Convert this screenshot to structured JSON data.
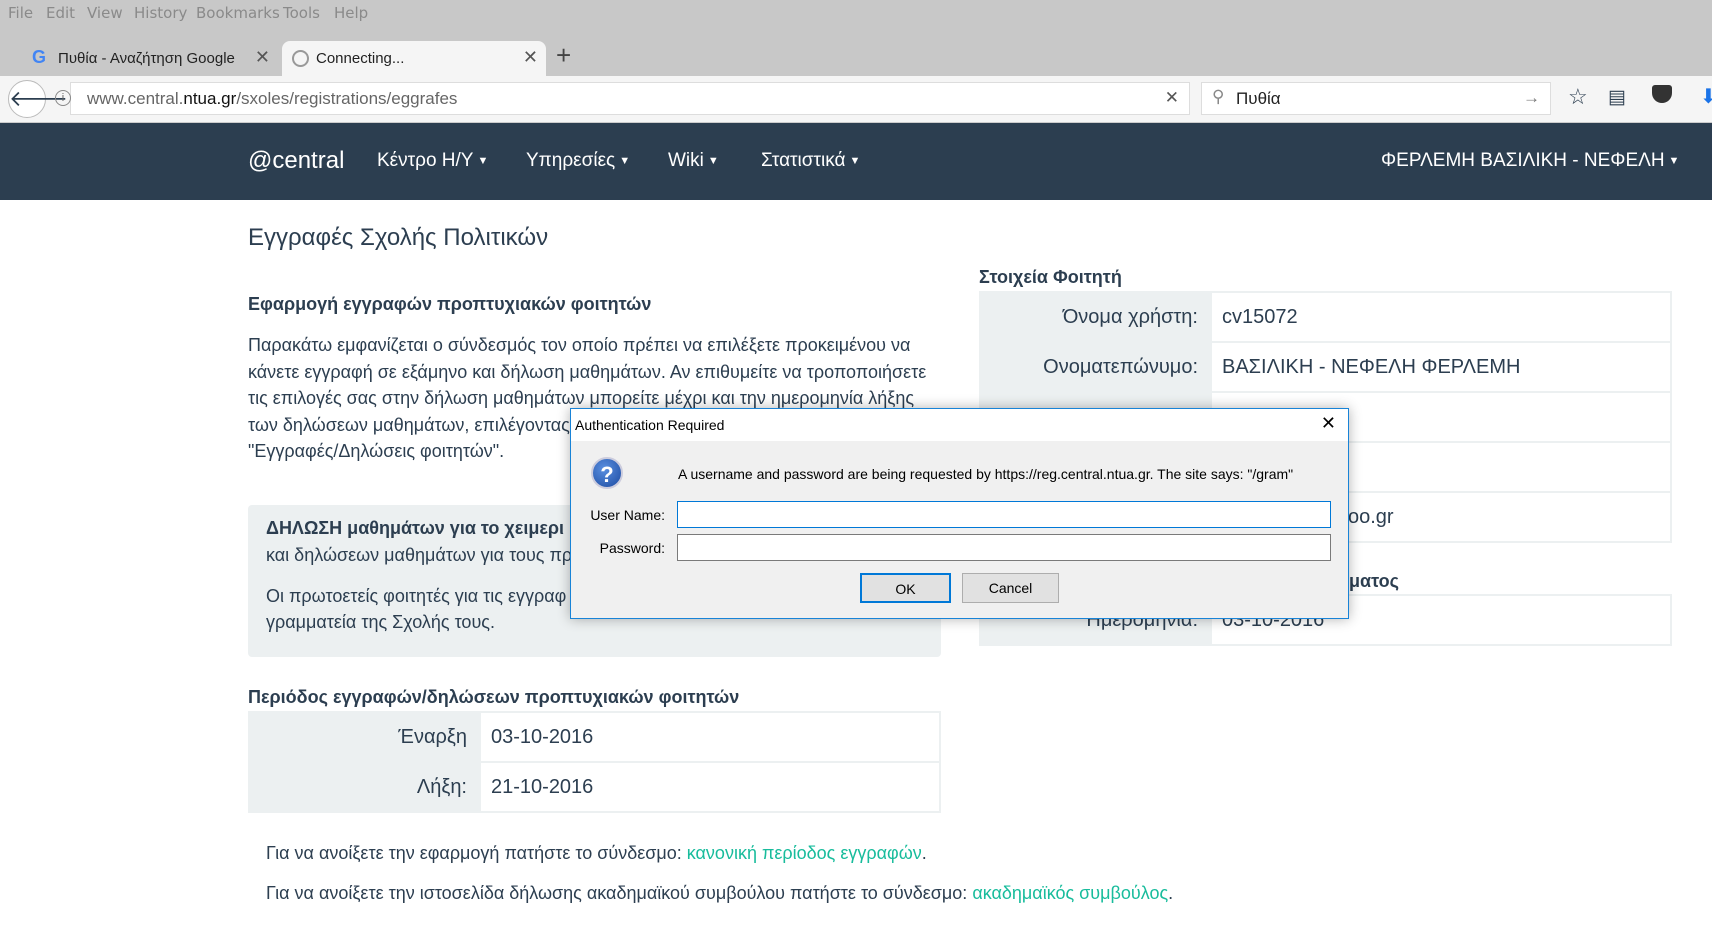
{
  "browser": {
    "menu": [
      "File",
      "Edit",
      "View",
      "History",
      "Bookmarks",
      "Tools",
      "Help"
    ],
    "tabs": [
      {
        "title": "Πυθία - Αναζήτηση Google"
      },
      {
        "title": "Connecting..."
      }
    ],
    "url_prefix": "www.central.",
    "url_domain": "ntua.gr",
    "url_path": "/sxoles/registrations/eggrafes",
    "search_value": "Πυθία"
  },
  "navbar": {
    "brand": "@central",
    "items": [
      "Κέντρο Η/Υ",
      "Υπηρεσίες",
      "Wiki",
      "Στατιστικά"
    ],
    "user": "ΦΕΡΛΕΜΗ ΒΑΣΙΛΙΚΗ - ΝΕΦΕΛΗ",
    "bg": "#2c3e50"
  },
  "page": {
    "title": "Εγγραφές Σχολής Πολιτικών",
    "app_heading": "Εφαρμογή εγγραφών προπτυχιακών φοιτητών",
    "intro_lines": [
      "Παρακάτω εμφανίζεται ο σύνδεσμός τον οποίο πρέπει να επιλέξετε προκειμένου να",
      "κάνετε εγγραφή σε εξάμηνο και δήλωση μαθημάτων. Αν επιθυμείτε να τροποποιήσετε",
      "τις επιλογές σας στην δήλωση μαθημάτων μπορείτε μέχρι και την ημερομηνία λήξης",
      "των δηλώσεων μαθημάτων, επιλέγοντας",
      "\"Εγγραφές/Δηλώσεις φοιτητών\"."
    ],
    "notice": {
      "bold": "ΔΗΛΩΣΗ μαθημάτων για το χειμερι",
      "line2": "και δηλώσεων μαθημάτων για τους πρ",
      "line3": "Οι πρωτοετείς φοιτητές για τις εγγραφ",
      "line4": "γραμματεία της Σχολής τους."
    },
    "period_heading": "Περιόδος εγγραφών/δηλώσεων προπτυχιακών φοιτητών",
    "period": [
      {
        "label": "Έναρξη",
        "value": "03-10-2016"
      },
      {
        "label": "Λήξη:",
        "value": "21-10-2016"
      }
    ],
    "link1_text": "Για να ανοίξετε την εφαρμογή πατήστε το σύνδεσμο: ",
    "link1": "κανονική περίοδος εγγραφών",
    "link2_text": "Για να ανοίξετε την ιστοσελίδα δήλωσης ακαδημαϊκού συμβούλου πατήστε το σύνδεσμο: ",
    "link2": "ακαδημαϊκός συμβούλος",
    "period_end": ".",
    "link_color": "#18bc9c"
  },
  "student": {
    "heading": "Στοιχεία Φοιτητή",
    "rows": [
      {
        "label": "Όνομα χρήστη:",
        "value": "cv15072"
      },
      {
        "label": "Ονοματεπώνυμο:",
        "value": "ΒΑΣΙΛΙΚΗ - ΝΕΦΕΛΗ ΦΕΡΛΕΜΗ"
      },
      {
        "label": "",
        "value": ""
      },
      {
        "label": "",
        "value": ""
      },
      {
        "label": "",
        "value": "oo.gr"
      }
    ],
    "heading2_partial": "ματος",
    "row2_label": "Ημερομηνία:",
    "row2_value": "03-10-2016"
  },
  "dialog": {
    "title": "Authentication Required",
    "message": "A username and password are being requested by https://reg.central.ntua.gr. The site says: \"/gram\"",
    "username_label": "User Name:",
    "username_value": "",
    "password_label": "Password:",
    "password_value": "",
    "ok": "OK",
    "cancel": "Cancel"
  }
}
